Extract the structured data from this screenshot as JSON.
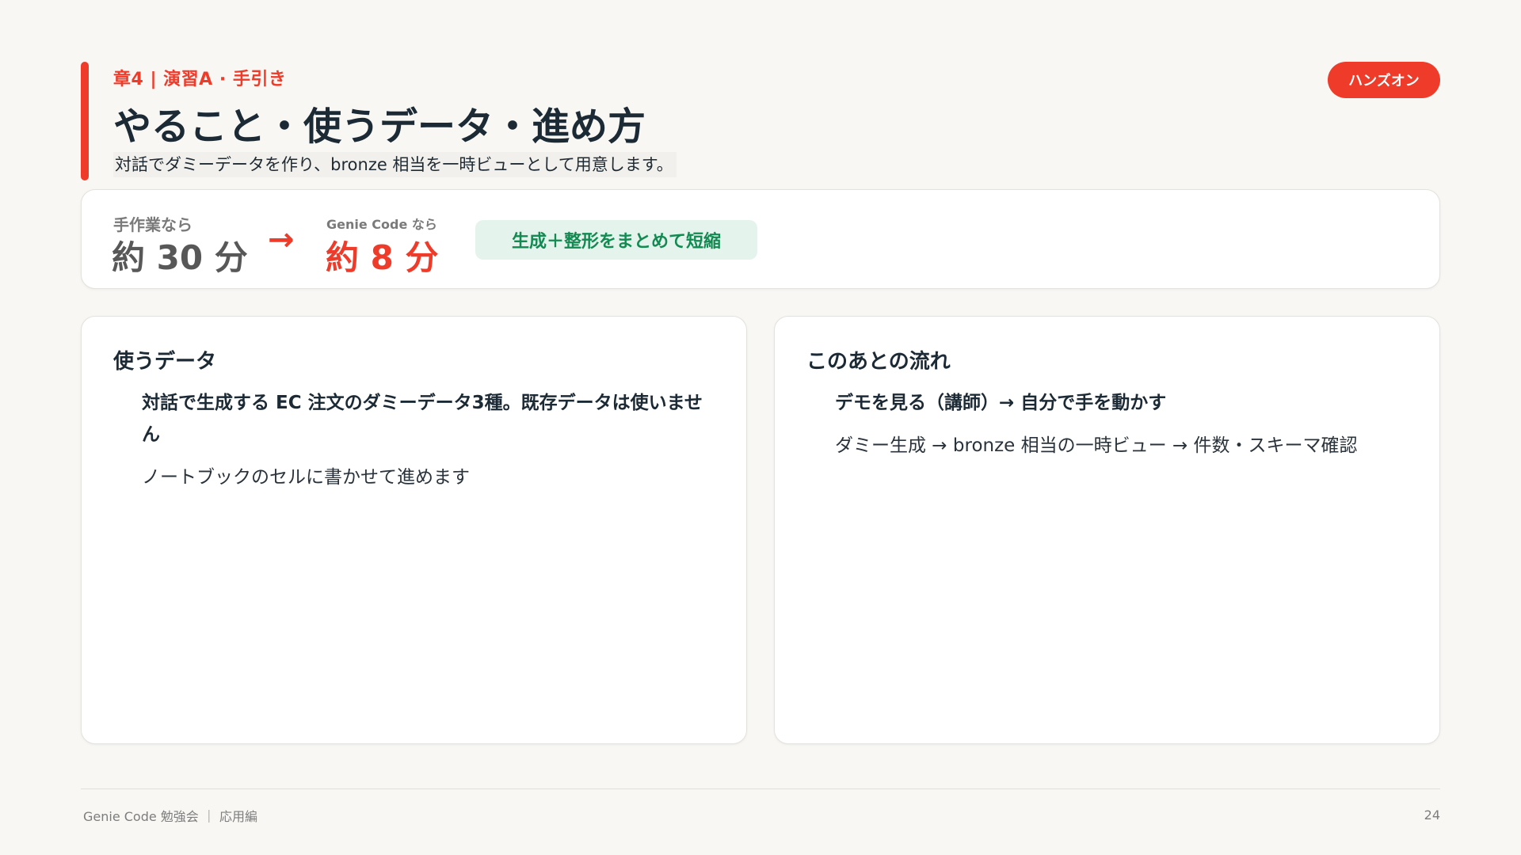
{
  "header": {
    "eyebrow": "章4 | 演習A · 手引き",
    "title": "やること・使うデータ・進め方",
    "subtitle": "対話でダミーデータを作り、bronze 相当を一時ビューとして用意します。",
    "badge": "ハンズオン"
  },
  "time_comparison": {
    "manual_label": "手作業なら",
    "manual_value": "約 30 分",
    "arrow": "→",
    "genie_label": "Genie Code なら",
    "genie_value": "約 8 分",
    "summary": "生成＋整形をまとめて短縮"
  },
  "left_panel": {
    "heading": "使うデータ",
    "lead": "対話で生成する EC 注文のダミーデータ3種。既存データは使いません",
    "body": "ノートブックのセルに書かせて進めます"
  },
  "right_panel": {
    "heading": "このあとの流れ",
    "lead": "デモを見る（講師）→ 自分で手を動かす",
    "body": "ダミー生成 → bronze 相当の一時ビュー → 件数・スキーマ確認"
  },
  "footer": {
    "text": "Genie Code 勉強会 ｜ 応用編",
    "page_number": "24"
  },
  "colors": {
    "accent": "#ee3b2a",
    "success": "#138a52",
    "success_bg": "#e4f4ec"
  }
}
